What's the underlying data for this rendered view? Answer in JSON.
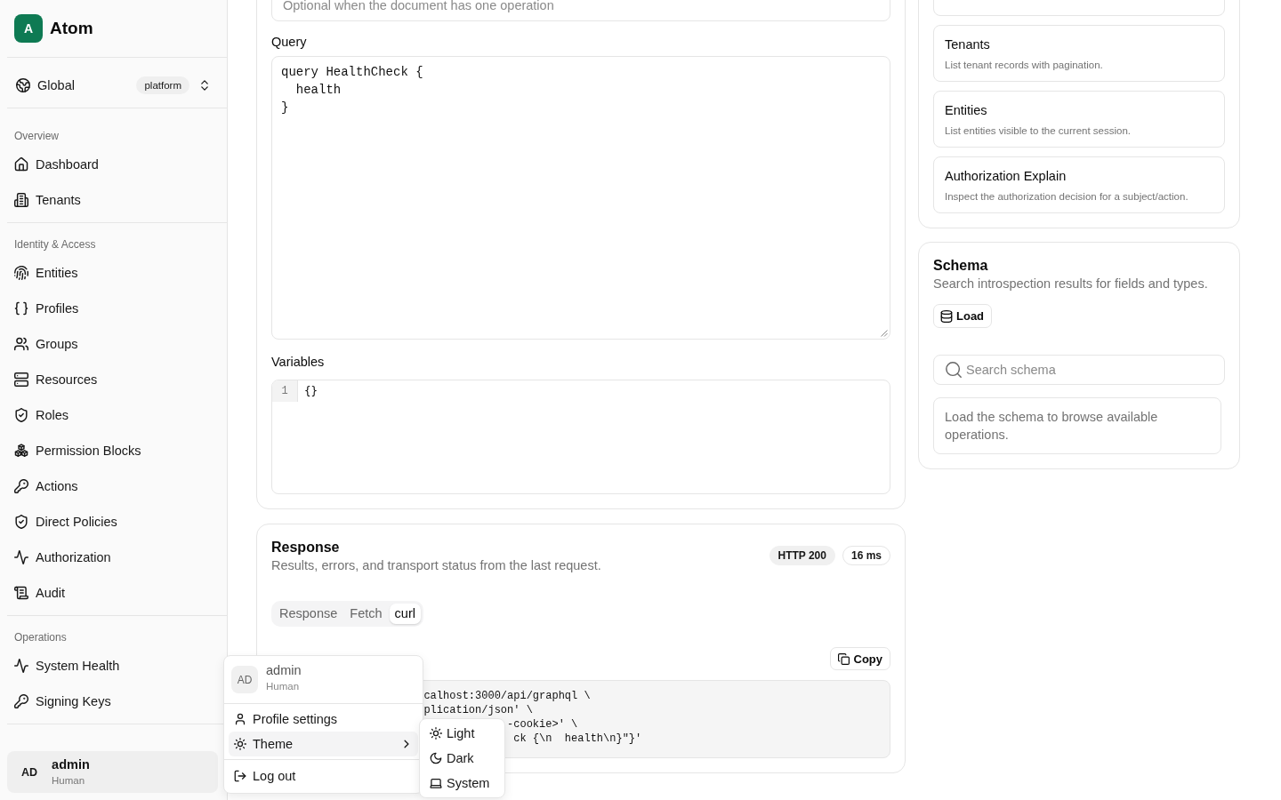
{
  "sidebar": {
    "brand": {
      "logo_letter": "A",
      "name": "Atom"
    },
    "scope": {
      "label": "Global",
      "badge": "platform"
    },
    "sections": [
      {
        "title": "Overview",
        "items": [
          {
            "label": "Dashboard",
            "selected": false
          },
          {
            "label": "Tenants",
            "selected": false
          }
        ]
      },
      {
        "title": "Identity & Access",
        "items": [
          {
            "label": "Entities",
            "selected": false
          },
          {
            "label": "Profiles",
            "selected": false
          },
          {
            "label": "Groups",
            "selected": false
          },
          {
            "label": "Resources",
            "selected": false
          },
          {
            "label": "Roles",
            "selected": false
          },
          {
            "label": "Permission Blocks",
            "selected": false
          },
          {
            "label": "Actions",
            "selected": false
          },
          {
            "label": "Direct Policies",
            "selected": false
          },
          {
            "label": "Authorization",
            "selected": false
          },
          {
            "label": "Audit",
            "selected": false
          }
        ]
      },
      {
        "title": "Operations",
        "items": [
          {
            "label": "System Health",
            "selected": false
          },
          {
            "label": "Signing Keys",
            "selected": false
          }
        ]
      }
    ],
    "user": {
      "initials": "AD",
      "name": "admin",
      "role": "Human"
    }
  },
  "query_panel": {
    "operation_name": {
      "placeholder": "Optional when the document has one operation"
    },
    "query_label": "Query",
    "query": {
      "value": "query HealthCheck {\n  health\n}"
    },
    "variables_label": "Variables",
    "variables": {
      "lines": [
        {
          "number": "1",
          "text": "{}"
        }
      ]
    }
  },
  "response_panel": {
    "title": "Response",
    "subtitle": "Results, errors, and transport status from the last request.",
    "badges": [
      {
        "text": "HTTP 200",
        "kind": "filled"
      },
      {
        "text": "16 ms",
        "kind": "outline"
      }
    ],
    "tabs": [
      {
        "label": "Response",
        "selected": false
      },
      {
        "label": "Fetch",
        "selected": false
      },
      {
        "label": "curl",
        "selected": true
      }
    ],
    "copy_button": "Copy",
    "code_lines": [
      "calhost:3000/api/graphql \\",
      "plication/json' \\",
      "-cookie>' \\",
      "ck {\\n  health\\n}\"}'"
    ]
  },
  "operations_panel": {
    "cards": [
      {
        "kind": "clipped"
      },
      {
        "kind": "operation",
        "title": "Tenants",
        "description": "List tenant records with pagination."
      },
      {
        "kind": "operation",
        "title": "Entities",
        "description": "List entities visible to the current session."
      },
      {
        "kind": "operation",
        "title": "Authorization Explain",
        "description": "Inspect the authorization decision for a subject/action."
      }
    ]
  },
  "schema_panel": {
    "title": "Schema",
    "subtitle": "Search introspection results for fields and types.",
    "load_button": "Load",
    "search": {
      "placeholder": "Search schema"
    },
    "empty_message": "Load the schema to browse available operations."
  },
  "user_menu": {
    "initials": "AD",
    "name": "admin",
    "role": "Human",
    "groups": [
      {
        "items": [
          {
            "label": "Profile settings"
          },
          {
            "label": "Theme",
            "expanded": true,
            "submenu": [
              {
                "label": "Light"
              },
              {
                "label": "Dark"
              },
              {
                "label": "System"
              }
            ]
          }
        ]
      },
      {
        "items": [
          {
            "label": "Log out"
          }
        ]
      }
    ]
  }
}
